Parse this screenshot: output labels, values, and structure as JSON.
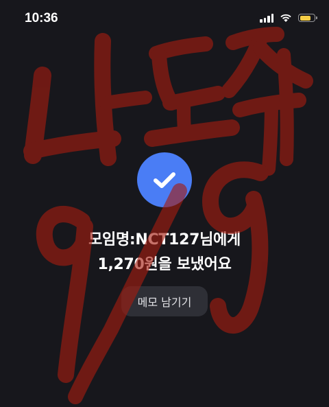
{
  "status_bar": {
    "time": "10:36",
    "battery_color": "#f5cd46"
  },
  "colors": {
    "background": "#17171c",
    "check_blue": "#4a7df5",
    "scribble_red": "#a51c10"
  },
  "transfer": {
    "recipient_line": "모임명:NCT127님에게",
    "amount_line": "1,270원을 보냈어요"
  },
  "memo_button": {
    "label": "메모 남기기"
  },
  "overlay": {
    "handwriting": "나도줘 9/9"
  }
}
